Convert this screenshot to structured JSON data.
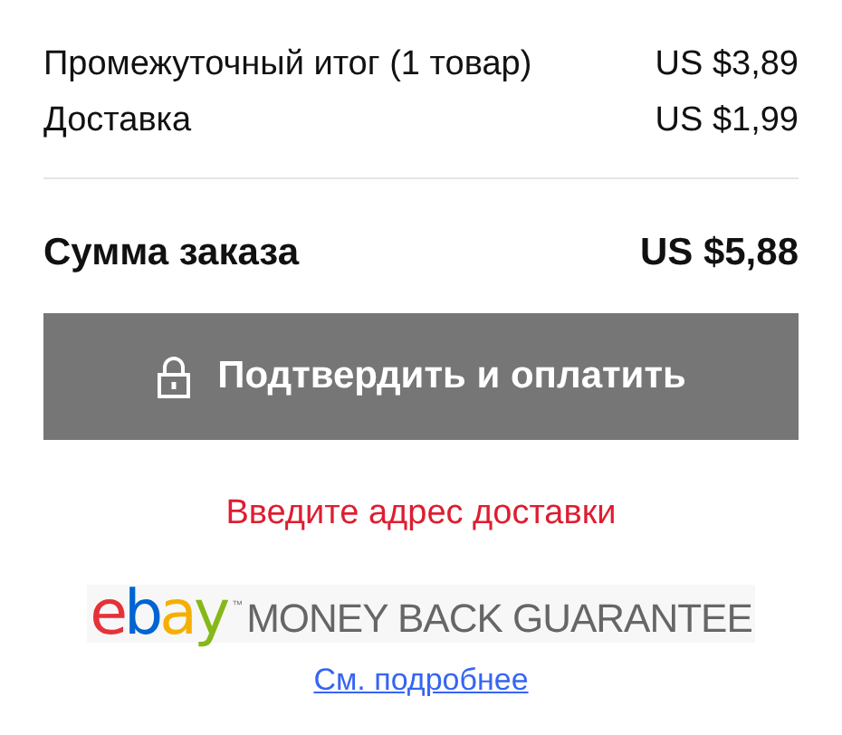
{
  "summary": {
    "rows": [
      {
        "label": "Промежуточный итог (1 товар)",
        "value": "US $3,89"
      },
      {
        "label": "Доставка",
        "value": "US $1,99"
      }
    ],
    "total": {
      "label": "Сумма заказа",
      "value": "US $5,88"
    }
  },
  "confirm_button": {
    "label": "Подтвердить и оплатить",
    "disabled": true
  },
  "error_message": "Введите адрес доставки",
  "guarantee": {
    "logo_letters": [
      {
        "text": "e",
        "color": "#e53238"
      },
      {
        "text": "b",
        "color": "#0064d2"
      },
      {
        "text": "a",
        "color": "#f5af02"
      },
      {
        "text": "y",
        "color": "#86b817"
      }
    ],
    "trademark": "™",
    "text": "MONEY BACK GUARANTEE",
    "link": "См. подробнее"
  }
}
